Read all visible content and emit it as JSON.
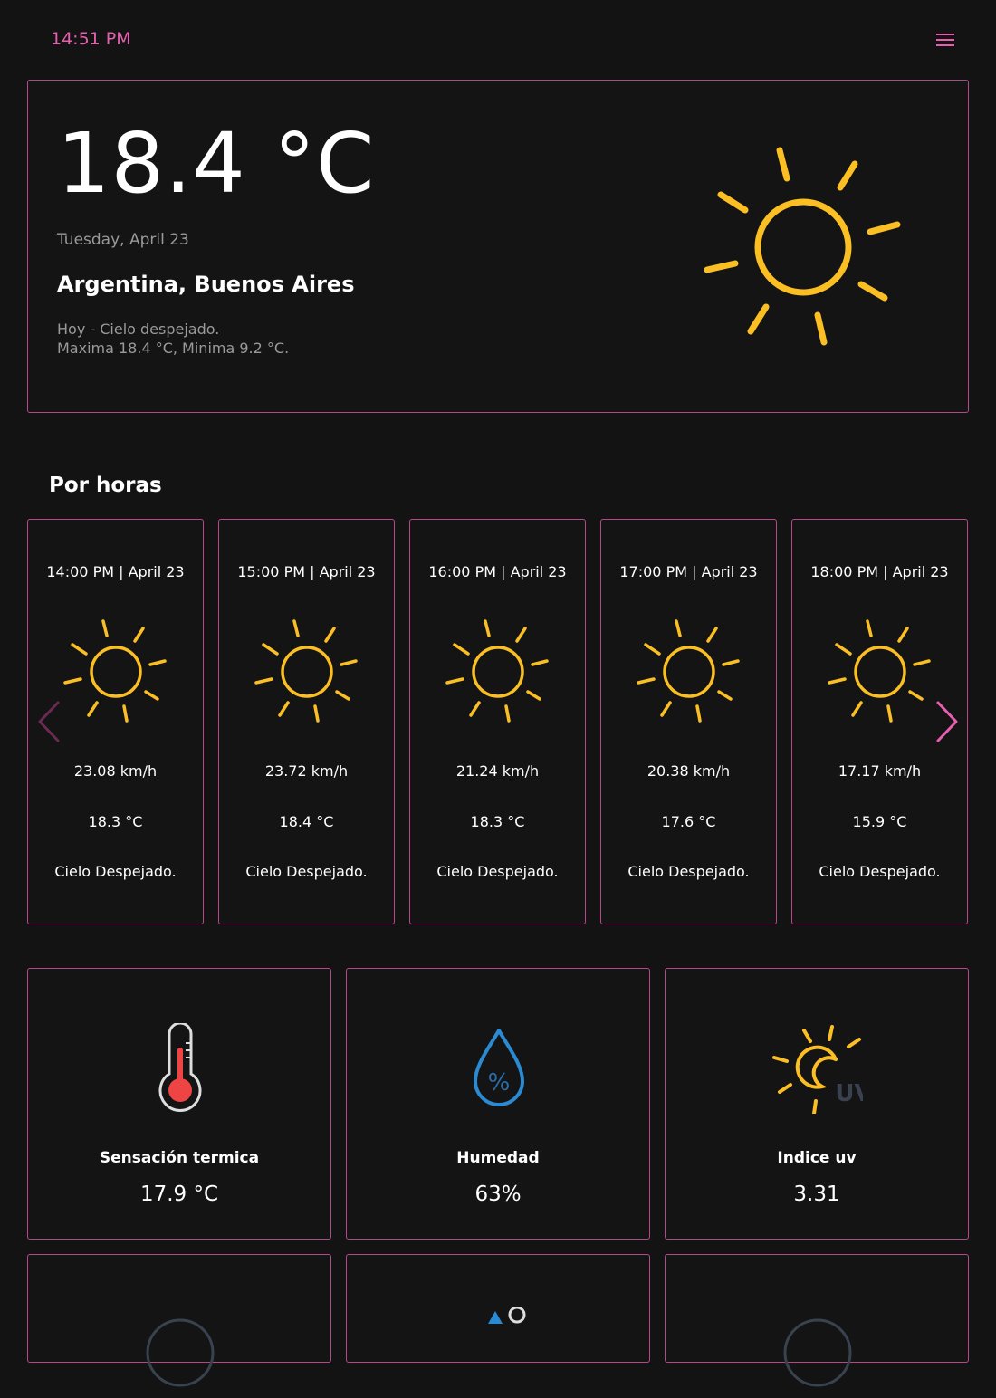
{
  "header": {
    "time": "14:51 PM",
    "menu_icon": "hamburger-menu-icon",
    "accent_color": "#e85fb0"
  },
  "current": {
    "temperature": "18.4 °C",
    "date": "Tuesday, April 23",
    "location": "Argentina, Buenos Aires",
    "summary_line1": "Hoy - Cielo despejado.",
    "summary_line2": "Maxima 18.4 °C, Minima 9.2 °C.",
    "icon": "sun-icon"
  },
  "hourly": {
    "title": "Por horas",
    "items": [
      {
        "time": "14:00 PM | April 23",
        "wind": "23.08 km/h",
        "temp": "18.3 °C",
        "desc": "Cielo Despejado.",
        "icon": "sun-icon"
      },
      {
        "time": "15:00 PM | April 23",
        "wind": "23.72 km/h",
        "temp": "18.4 °C",
        "desc": "Cielo Despejado.",
        "icon": "sun-icon"
      },
      {
        "time": "16:00 PM | April 23",
        "wind": "21.24 km/h",
        "temp": "18.3 °C",
        "desc": "Cielo Despejado.",
        "icon": "sun-icon"
      },
      {
        "time": "17:00 PM | April 23",
        "wind": "20.38 km/h",
        "temp": "17.6 °C",
        "desc": "Cielo Despejado.",
        "icon": "sun-icon"
      },
      {
        "time": "18:00 PM | April 23",
        "wind": "17.17 km/h",
        "temp": "15.9 °C",
        "desc": "Cielo Despejado.",
        "icon": "sun-icon"
      }
    ]
  },
  "stats": [
    {
      "label": "Sensación termica",
      "value": "17.9 °C",
      "icon": "thermometer-icon"
    },
    {
      "label": "Humedad",
      "value": "63%",
      "icon": "humidity-drop-icon"
    },
    {
      "label": "Indice uv",
      "value": "3.31",
      "icon": "uv-index-icon"
    }
  ],
  "colors": {
    "sun": "#fbbf24",
    "humidity": "#2a8ad4",
    "thermo": "#ef4444",
    "border": "#b8488a"
  }
}
